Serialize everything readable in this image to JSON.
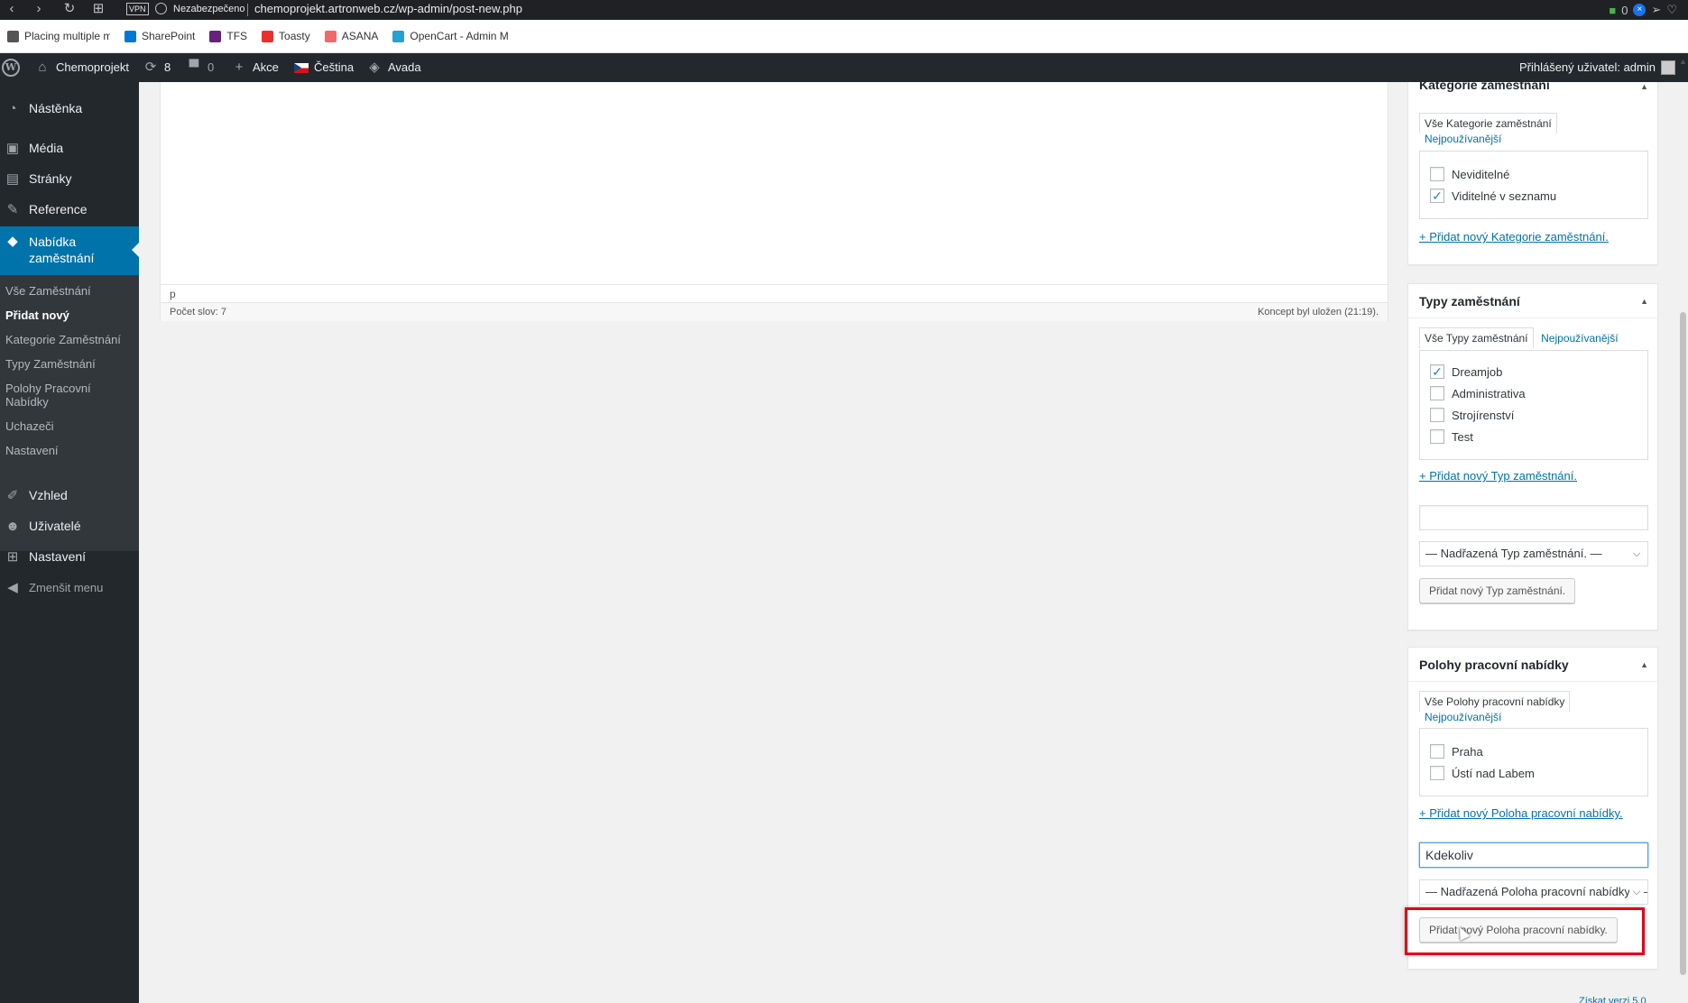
{
  "browser": {
    "vpn": "VPN",
    "insecure": "Nezabezpečeno",
    "url": "chemoprojekt.artronweb.cz/wp-admin/post-new.php",
    "ext_badge": "0",
    "bookmarks": [
      {
        "label": "Placing multiple mar",
        "color": "#555555"
      },
      {
        "label": "SharePoint",
        "color": "#0078d4"
      },
      {
        "label": "TFS",
        "color": "#68217a"
      },
      {
        "label": "Toasty",
        "color": "#e8312f"
      },
      {
        "label": "ASANA",
        "color": "#f06a6a"
      },
      {
        "label": "OpenCart - Admin M",
        "color": "#23a1d1"
      }
    ]
  },
  "adminbar": {
    "site": "Chemoprojekt",
    "updates": "8",
    "comments": "0",
    "new": "Akce",
    "language": "Čeština",
    "theme": "Avada",
    "user": "Přihlášený uživatel: admin"
  },
  "sidebar": {
    "items": [
      "Nástěnka",
      "Média",
      "Stránky",
      "Reference"
    ],
    "active_line1": "Nabídka",
    "active_line2": "zaměstnání",
    "submenu": [
      "Vše Zaměstnání",
      "Přidat nový",
      "Kategorie Zaměstnání",
      "Typy Zaměstnání",
      "Polohy Pracovní",
      "Nabídky",
      "Uchazeči",
      "Nastavení"
    ],
    "items_bottom": [
      "Vzhled",
      "Uživatelé",
      "Nastavení"
    ],
    "collapse": "Zmenšit menu"
  },
  "editor": {
    "path": "p",
    "word_count": "Počet slov: 7",
    "saved": "Koncept byl uložen (21:19)."
  },
  "metabox_categories": {
    "title": "Kategorie zaměstnání",
    "tab_all": "Vše Kategorie zaměstnání",
    "tab_popular": "Nejpoužívanější",
    "items": [
      {
        "label": "Neviditelné",
        "checked": false
      },
      {
        "label": "Viditelné v seznamu",
        "checked": true
      }
    ],
    "add_link": "+ Přidat nový Kategorie zaměstnání."
  },
  "metabox_types": {
    "title": "Typy zaměstnání",
    "tab_all": "Vše Typy zaměstnání",
    "tab_popular": "Nejpoužívanější",
    "items": [
      {
        "label": "Dreamjob",
        "checked": true
      },
      {
        "label": "Administrativa",
        "checked": false
      },
      {
        "label": "Strojírenství",
        "checked": false
      },
      {
        "label": "Test",
        "checked": false
      }
    ],
    "add_link": "+ Přidat nový Typ zaměstnání.",
    "new_value": "",
    "parent_select": "— Nadřazená Typ zaměstnání. —",
    "add_button": "Přidat nový Typ zaměstnání."
  },
  "metabox_locations": {
    "title": "Polohy pracovní nabídky",
    "tab_all": "Vše Polohy pracovní nabídky",
    "tab_popular": "Nejpoužívanější",
    "items": [
      {
        "label": "Praha",
        "checked": false
      },
      {
        "label": "Ústí nad Labem",
        "checked": false
      }
    ],
    "add_link": "+ Přidat nový Poloha pracovní nabídky.",
    "new_value": "Kdekoliv",
    "parent_select": "— Nadřazená Poloha pracovní nabídky. —",
    "add_button": "Přidat nový Poloha pracovní nabídky."
  },
  "footer": {
    "version": "Získat verzi 5.0"
  },
  "colors": {
    "accent": "#0073aa",
    "adminbar": "#23282d",
    "highlight": "#e2001a"
  }
}
